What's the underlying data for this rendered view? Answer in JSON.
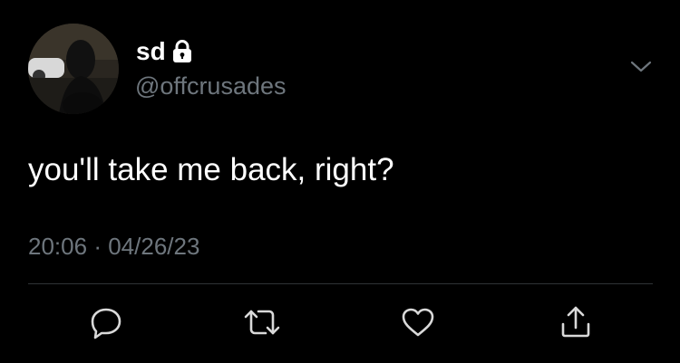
{
  "user": {
    "display_name": "sd",
    "handle": "@offcrusades",
    "avatar_icon": "profile-photo",
    "protected_icon": "lock-icon"
  },
  "tweet": {
    "text": "you'll take me back, right?",
    "time": "20:06",
    "separator": "·",
    "date": "04/26/23"
  },
  "actions": [
    {
      "name": "reply",
      "icon": "reply-icon"
    },
    {
      "name": "retweet",
      "icon": "retweet-icon"
    },
    {
      "name": "like",
      "icon": "heart-icon"
    },
    {
      "name": "share",
      "icon": "share-icon"
    }
  ],
  "colors": {
    "background": "#000000",
    "primary_text": "#ffffff",
    "secondary_text": "#6e767d",
    "icon": "#d9d9d9",
    "divider": "#2f3336"
  }
}
